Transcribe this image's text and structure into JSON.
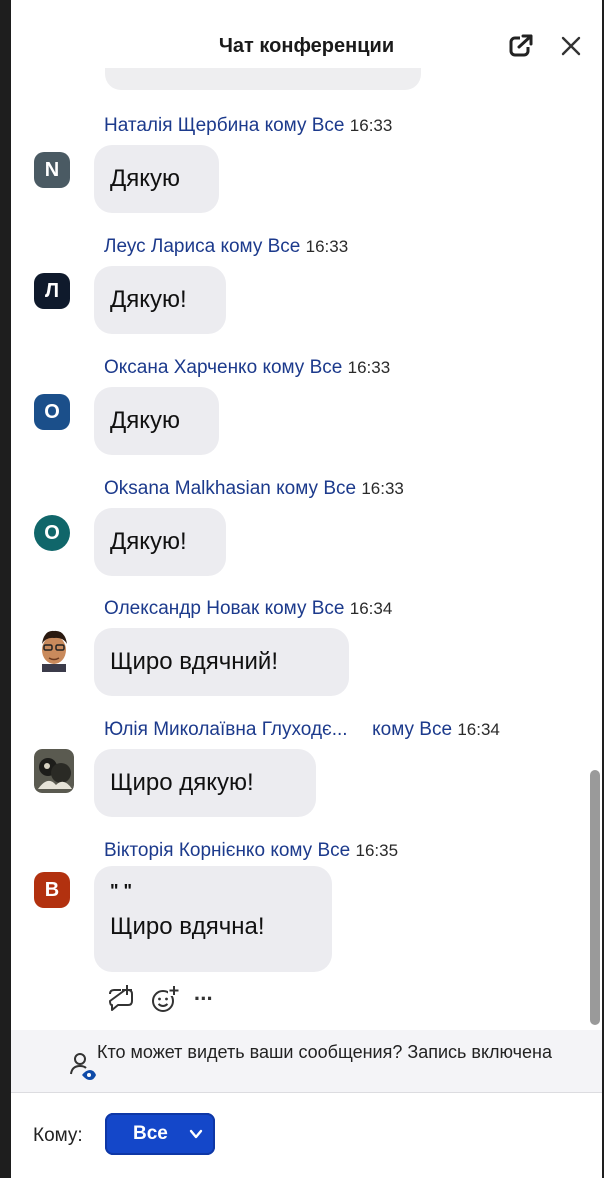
{
  "header": {
    "title": "Чат конференции",
    "icons": [
      "popout-icon",
      "close-icon"
    ]
  },
  "messages": [
    {
      "sender": "Наталія Щербина",
      "to_word": "кому",
      "recipient": "Все",
      "time": "16:33",
      "avatar_letter": "N",
      "avatar_color": "#4a5a63",
      "lines": [
        "Дякую"
      ]
    },
    {
      "sender": "Леус Лариса",
      "to_word": "кому",
      "recipient": "Все",
      "time": "16:33",
      "avatar_letter": "Л",
      "avatar_color": "#0f1a2c",
      "lines": [
        "Дякую!"
      ]
    },
    {
      "sender": "Оксана Харченко",
      "to_word": "кому",
      "recipient": "Все",
      "time": "16:33",
      "avatar_letter": "О",
      "avatar_color": "#1b4f8a",
      "lines": [
        "Дякую"
      ]
    },
    {
      "sender": "Oksana Malkhasian",
      "to_word": "кому",
      "recipient": "Все",
      "time": "16:33",
      "avatar_letter": "O",
      "avatar_color": "#10666a",
      "lines": [
        "Дякую!"
      ]
    },
    {
      "sender": "Олександр Новак",
      "to_word": "кому",
      "recipient": "Все",
      "time": "16:34",
      "avatar_letter": "",
      "avatar_color": "#c98a5c",
      "lines": [
        "Щиро вдячний!"
      ]
    },
    {
      "sender": "Юлія Миколаївна Глуходє...",
      "to_word": "кому",
      "recipient": "Все",
      "time": "16:34",
      "avatar_letter": "",
      "avatar_color": "#3a3a34",
      "lines": [
        "Щиро дякую!"
      ]
    },
    {
      "sender": "Вікторія Корнієнко",
      "to_word": "кому",
      "recipient": "Все",
      "time": "16:35",
      "avatar_letter": "В",
      "avatar_color": "#b2310f",
      "lines": [
        "\"  \"",
        "Щиро вдячна!"
      ]
    }
  ],
  "actions": [
    "reply-icon",
    "add-reaction-icon",
    "more-icon"
  ],
  "actions_more_label": "···",
  "privacy": {
    "text": "Кто может видеть ваши сообщения? Запись включена"
  },
  "to_row": {
    "label": "Кому:",
    "selected": "Все",
    "accent": "#1447c9"
  }
}
